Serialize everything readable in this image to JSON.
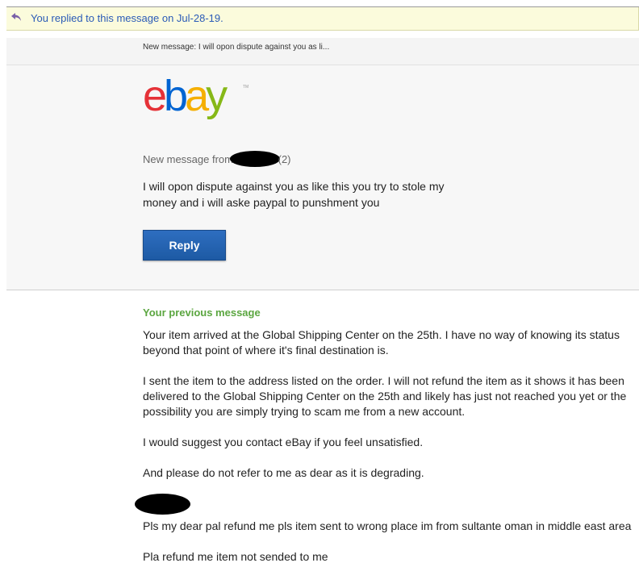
{
  "notice": {
    "icon": "reply-arrow-icon",
    "text": "You replied to this message on Jul-28-19."
  },
  "preheader": {
    "text": "New message: I will opon dispute against you as li..."
  },
  "logo": {
    "icon": "ebay-logo",
    "letters": [
      "e",
      "b",
      "a",
      "y"
    ],
    "colors": [
      "#e53238",
      "#0064d2",
      "#f5af02",
      "#86b817"
    ],
    "tm": "TM"
  },
  "message": {
    "from_prefix": "New message from",
    "from_suffix": "(2)",
    "body": "I will opon dispute against you as like this you try to stole my money and i will aske paypal to punshment you",
    "reply_label": "Reply"
  },
  "previous": {
    "heading": "Your previous message",
    "paragraphs": [
      "Your item arrived at the Global Shipping Center on the 25th. I have no way of knowing its status beyond that point of where it's final destination is.",
      "I sent the item to the address listed on the order. I will not refund the item as it shows it has been delivered to the Global Shipping Center on the 25th and likely has just not reached you yet or the possibility you are simply trying to scam me from a new account.",
      "I would suggest you contact eBay if you feel unsatisfied.",
      "And please do not refer to me as dear as it is degrading."
    ]
  },
  "earlier": {
    "line1": "Pls my dear pal refund me pls item sent to wrong place im from sultante oman in middle east area",
    "line2": "Pla refund me item not sended to me"
  },
  "colors": {
    "notice_bg": "#fbfbdc",
    "link_blue": "#2b5bb7",
    "button_blue": "#1d5aa4",
    "heading_green": "#5ba640"
  }
}
